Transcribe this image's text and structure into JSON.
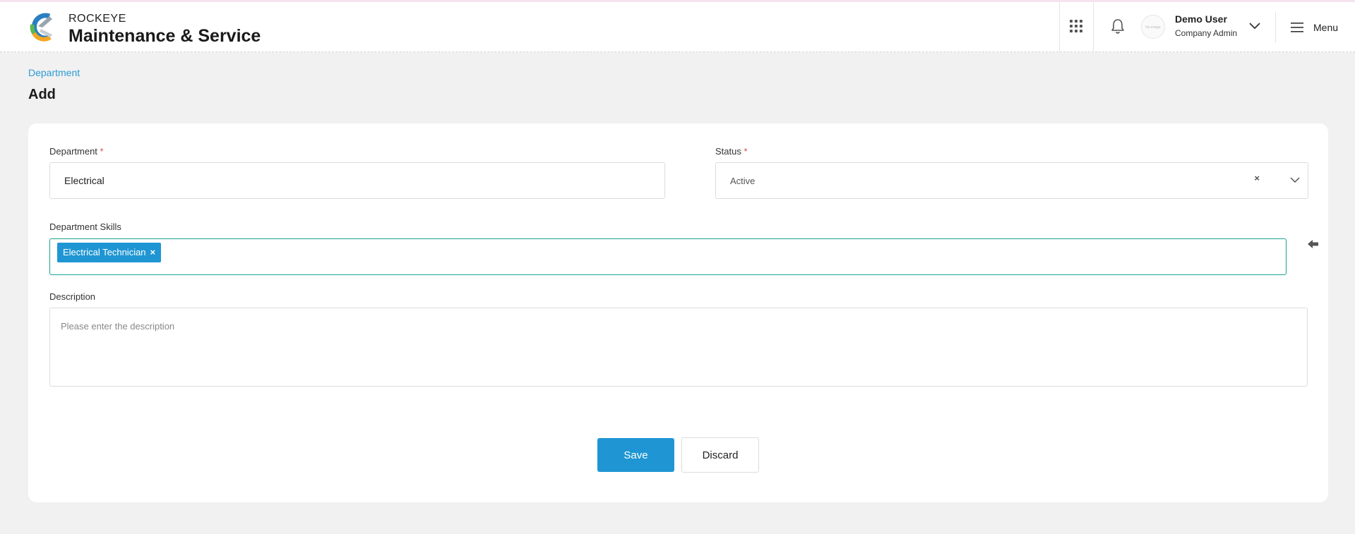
{
  "brand": {
    "small": "ROCKEYE",
    "title": "Maintenance & Service",
    "logo_icon": "rockeye-logo-icon"
  },
  "header": {
    "apps_icon": "grid-apps-icon",
    "notifications_icon": "bell-icon",
    "avatar_placeholder": "No image",
    "user_name": "Demo User",
    "user_role": "Company Admin",
    "menu_label": "Menu"
  },
  "page": {
    "breadcrumb": "Department",
    "title": "Add"
  },
  "form": {
    "department": {
      "label": "Department",
      "required_mark": "*",
      "value": "Electrical"
    },
    "status": {
      "label": "Status",
      "required_mark": "*",
      "value": "Active",
      "clear": "×"
    },
    "skills": {
      "label": "Department Skills",
      "chips": [
        "Electrical Technician"
      ],
      "chip_remove": "×"
    },
    "description": {
      "label": "Description",
      "placeholder": "Please enter the description",
      "value": ""
    }
  },
  "actions": {
    "save": "Save",
    "discard": "Discard"
  },
  "colors": {
    "accent": "#1f96d3",
    "link": "#2d9bd6",
    "focus_border": "#1aa58e",
    "required": "#e14a4a",
    "background": "#f1f1f1"
  }
}
